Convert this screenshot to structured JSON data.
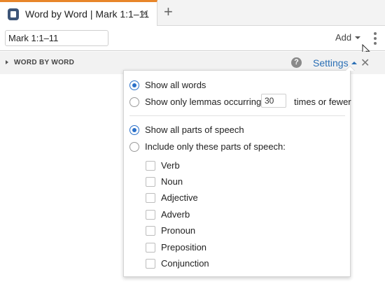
{
  "tab": {
    "title": "Word by Word | Mark 1:1–11",
    "close_glyph": "✕",
    "add_glyph": "+"
  },
  "toolbar": {
    "reference_value": "Mark 1:1–11",
    "add_label": "Add"
  },
  "panel": {
    "title": "WORD BY WORD",
    "help_glyph": "?",
    "settings_label": "Settings",
    "close_glyph": "✕"
  },
  "settings": {
    "word_filter": {
      "show_all_label": "Show all words",
      "show_all_selected": true,
      "lemmas_prefix": "Show only lemmas occurring",
      "lemmas_count": "30",
      "lemmas_suffix": "times or fewer"
    },
    "pos_filter": {
      "show_all_label": "Show all parts of speech",
      "show_all_selected": true,
      "include_only_label": "Include only these parts of speech:",
      "options": [
        {
          "label": "Verb",
          "checked": false
        },
        {
          "label": "Noun",
          "checked": false
        },
        {
          "label": "Adjective",
          "checked": false
        },
        {
          "label": "Adverb",
          "checked": false
        },
        {
          "label": "Pronoun",
          "checked": false
        },
        {
          "label": "Preposition",
          "checked": false
        },
        {
          "label": "Conjunction",
          "checked": false
        }
      ]
    }
  },
  "colors": {
    "accent_orange": "#e8862a",
    "link_blue": "#2a6fb5",
    "radio_blue": "#2b70c9",
    "tab_icon": "#3d5578"
  }
}
